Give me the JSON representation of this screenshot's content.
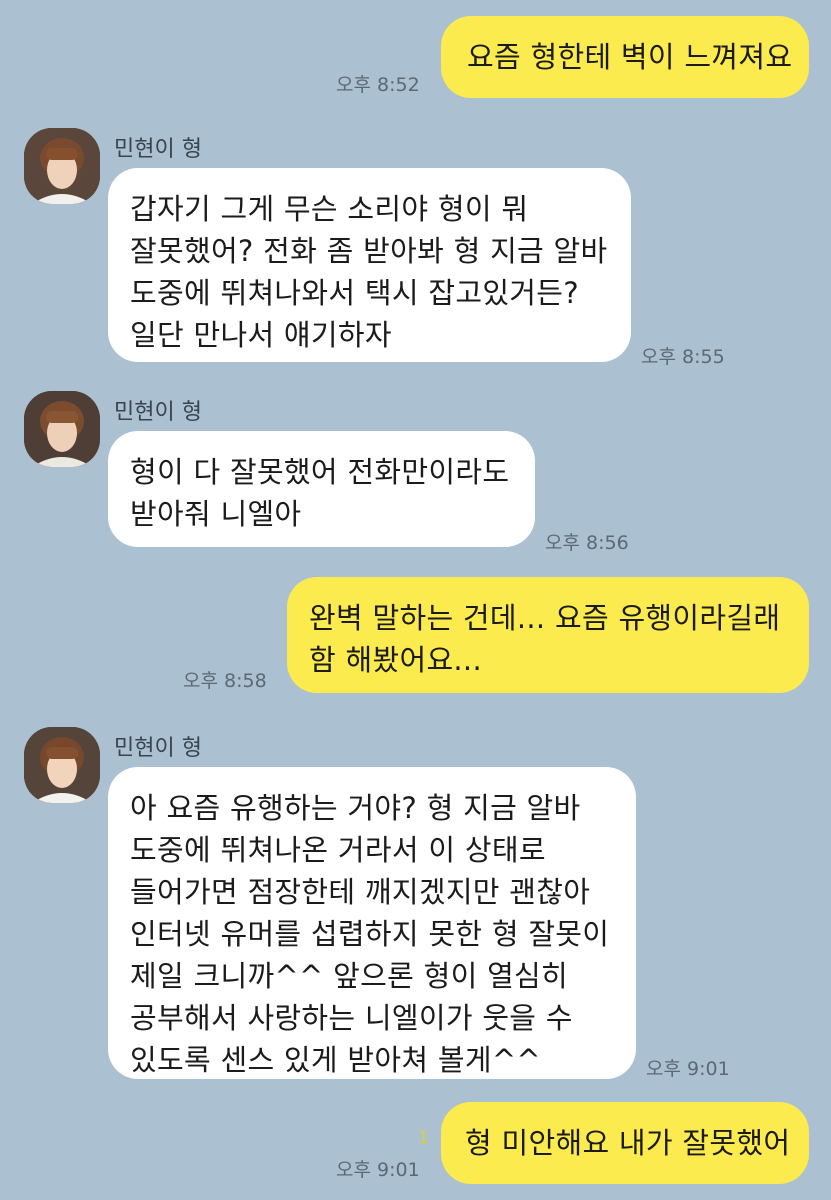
{
  "messages": [
    {
      "side": "mine",
      "lines": [
        "요즘 형한테 벽이 느껴져요"
      ],
      "time": "오후 8:52"
    },
    {
      "side": "theirs",
      "sender": "민현이 형",
      "lines": [
        "갑자기 그게 무슨 소리야 형이 뭐",
        "잘못했어? 전화 좀 받아봐 형 지금 알바",
        "도중에 뛰쳐나와서 택시 잡고있거든?",
        "일단 만나서 얘기하자"
      ],
      "time": "오후 8:55"
    },
    {
      "side": "theirs",
      "sender": "민현이 형",
      "lines": [
        "형이 다 잘못했어 전화만이라도",
        "받아줘 니엘아"
      ],
      "time": "오후 8:56"
    },
    {
      "side": "mine",
      "lines": [
        "완벽 말하는 건데... 요즘 유행이라길래",
        "함 해봤어요..."
      ],
      "time": "오후 8:58"
    },
    {
      "side": "theirs",
      "sender": "민현이 형",
      "lines": [
        "아 요즘 유행하는 거야? 형 지금 알바",
        "도중에 뛰쳐나온 거라서 이 상태로",
        "들어가면 점장한테 깨지겠지만 괜찮아",
        "인터넷 유머를 섭렵하지 못한 형 잘못이",
        "제일 크니까^^ 앞으론 형이 열심히",
        "공부해서 사랑하는 니엘이가 웃을 수",
        "있도록 센스 있게 받아쳐 볼게^^"
      ],
      "time": "오후 9:01"
    },
    {
      "side": "mine",
      "lines": [
        "형 미안해요 내가 잘못했어"
      ],
      "time": "오후 9:01",
      "unread": "1"
    }
  ],
  "colors": {
    "background": "#abc1d1",
    "my_bubble": "#fbeb4f",
    "their_bubble": "#ffffff",
    "unread_count": "#e0cf2f"
  },
  "icons": {
    "avatar": "profile-photo"
  }
}
